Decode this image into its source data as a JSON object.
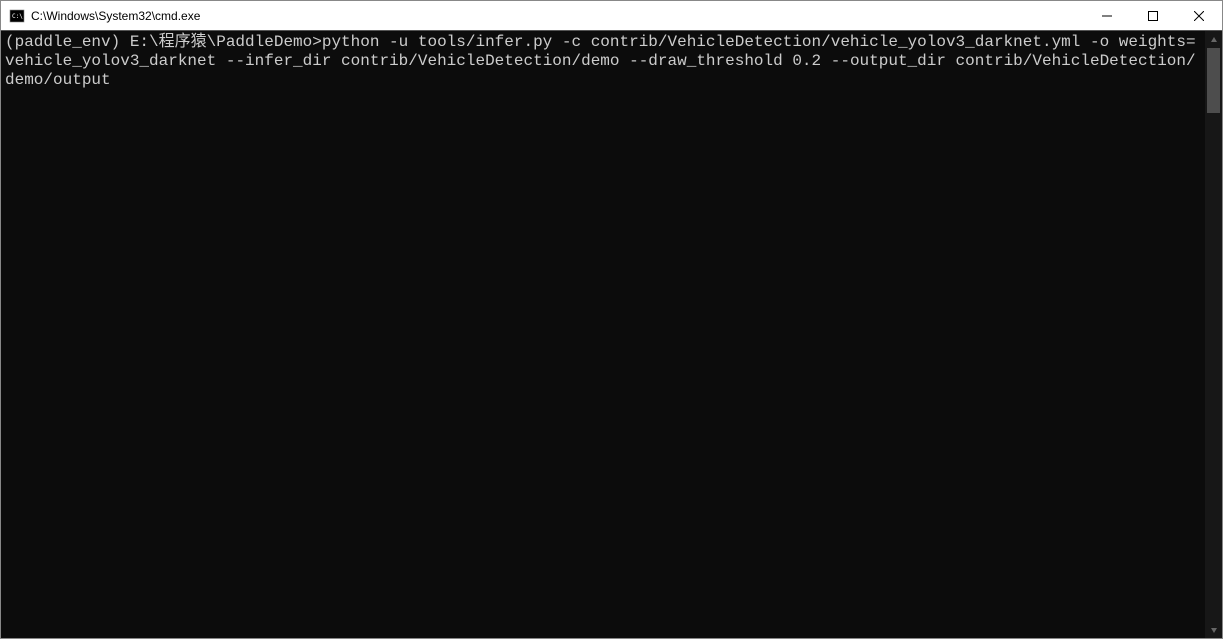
{
  "window": {
    "title": "C:\\Windows\\System32\\cmd.exe"
  },
  "terminal": {
    "content": "(paddle_env) E:\\程序猿\\PaddleDemo>python -u tools/infer.py -c contrib/VehicleDetection/vehicle_yolov3_darknet.yml -o weights=vehicle_yolov3_darknet --infer_dir contrib/VehicleDetection/demo --draw_threshold 0.2 --output_dir contrib/VehicleDetection/demo/output"
  }
}
